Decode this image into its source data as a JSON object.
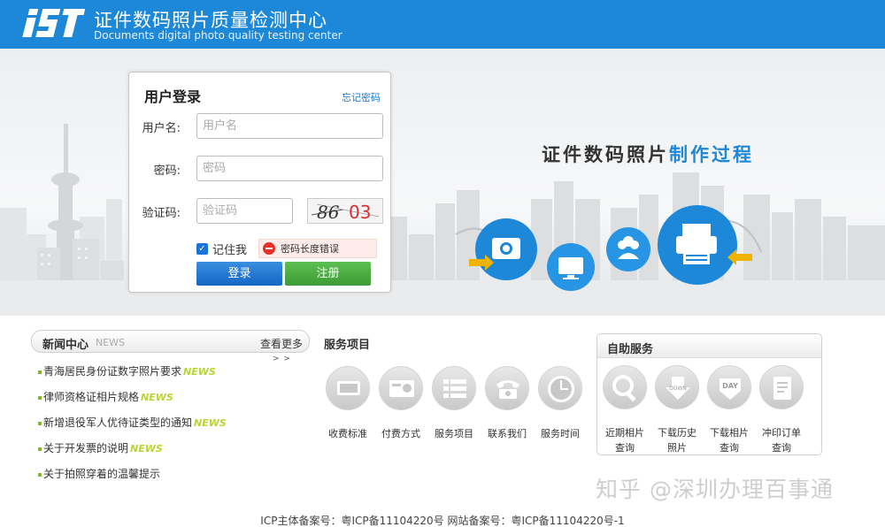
{
  "header": {
    "logo_text": "IST",
    "title": "证件数码照片质量检测中心",
    "subtitle": "Documents digital photo quality testing center"
  },
  "banner": {
    "process_title_black": "证件数码照片",
    "process_title_blue": "制作过程"
  },
  "login": {
    "title": "用户登录",
    "forgot_password": "忘记密码",
    "username_label": "用户名:",
    "username_placeholder": "用户名",
    "password_label": "密码:",
    "password_placeholder": "密码",
    "captcha_label": "验证码:",
    "captcha_placeholder": "验证码",
    "captcha_digits_dark": "86",
    "captcha_digits_red": "03",
    "remember_label": "记住我",
    "remember_checked": true,
    "error_message": "密码长度错误",
    "login_button": "登录",
    "register_button": "注册"
  },
  "news": {
    "title": "新闻中心",
    "title_en": "NEWS",
    "more": "查看更多",
    "more_arrows": "> >",
    "tag": "NEWS",
    "items": [
      {
        "text": "青海居民身份证数字照片要求",
        "tag": "NEWS"
      },
      {
        "text": "律师资格证相片规格",
        "tag": "NEWS"
      },
      {
        "text": "新增退役军人优待证类型的通知",
        "tag": "NEWS"
      },
      {
        "text": "关于开发票的说明",
        "tag": "NEWS"
      },
      {
        "text": "关于拍照穿着的温馨提示",
        "tag": ""
      }
    ]
  },
  "services": {
    "title": "服务项目",
    "items": [
      {
        "label": "收费标准",
        "icon": "money-icon"
      },
      {
        "label": "付费方式",
        "icon": "payment-card-icon"
      },
      {
        "label": "服务项目",
        "icon": "list-icon"
      },
      {
        "label": "联系我们",
        "icon": "phone-icon"
      },
      {
        "label": "服务时间",
        "icon": "clock-icon"
      }
    ]
  },
  "self_service": {
    "title": "自助服务",
    "items": [
      {
        "line1": "近期相片",
        "line2": "查询",
        "icon": "search-icon"
      },
      {
        "line1": "下载历史",
        "line2": "照片",
        "icon": "download-icon"
      },
      {
        "line1": "下载相片",
        "line2": "查询",
        "icon": "day-calendar-icon"
      },
      {
        "line1": "冲印订单",
        "line2": "查询",
        "icon": "order-document-icon"
      }
    ],
    "down_text": "DOWN",
    "day_text": "DAY"
  },
  "watermark": "知乎 @深圳办理百事通",
  "footer": {
    "icp": "ICP主体备案号：粤ICP备11104220号 网站备案号：粤ICP备11104220号-1"
  },
  "colors": {
    "brand_blue": "#1e88d8",
    "login_button": "#1466c4",
    "register_button": "#3d9c35",
    "news_tag": "#b8d632",
    "error_red": "#e4322b"
  }
}
